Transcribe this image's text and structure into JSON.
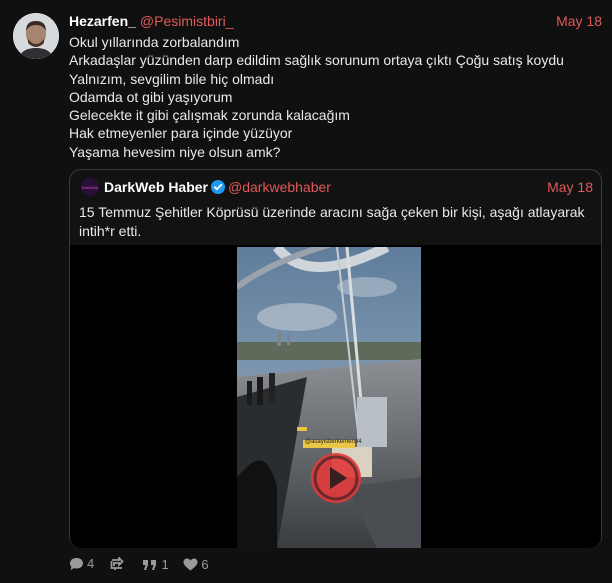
{
  "tweet": {
    "display_name": "Hezarfen_",
    "handle": "@Pesimistbiri_",
    "date": "May 18",
    "lines": [
      "Okul yıllarında zorbalandım",
      "Arkadaşlar yüzünden darp edildim sağlık sorunum ortaya çıktı Çoğu satış koydu",
      "Yalnızım, sevgilim bile hiç olmadı",
      "Odamda ot gibi yaşıyorum",
      "Gelecekte it gibi çalışmak zorunda kalacağım",
      "Hak etmeyenler para içinde yüzüyor",
      "Yaşama hevesim niye olsun amk?"
    ]
  },
  "quoted": {
    "display_name": "DarkWeb Haber",
    "avatar_text": "DarkWeb",
    "handle": "@darkwebhaber",
    "date": "May 18",
    "text": "15 Temmuz Şehitler Köprüsü üzerinde aracını sağa çeken bir kişi, aşağı atlayarak intih*r etti.",
    "video_watermark": "@asayisberkemen34"
  },
  "actions": {
    "replies": "4",
    "retweets": "",
    "quotes": "1",
    "likes": "6"
  },
  "colors": {
    "accent": "#e05a5a",
    "background": "#101010",
    "verified": "#1d9bf0"
  },
  "icons": [
    "reply-icon",
    "retweet-icon",
    "quote-icon",
    "heart-icon",
    "play-icon",
    "verified-badge-icon"
  ]
}
